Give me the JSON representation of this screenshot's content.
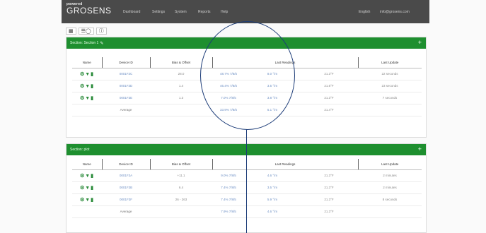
{
  "brand": {
    "tagline": "powered",
    "name": "GROSENS"
  },
  "nav": {
    "left": [
      "Dashboard",
      "Settings",
      "System",
      "Reports",
      "Help"
    ],
    "language": "English",
    "user": "info@grosens.com"
  },
  "toolbar": {
    "grid_view": "▦",
    "list_view": "☰◯",
    "info": "ⓘ"
  },
  "panels": [
    {
      "title": "Section: Section 1",
      "columns": {
        "name": "Name",
        "device": "Device ID",
        "bias": "Bias & Offset",
        "readings": "Last Readings",
        "update": "Last Update"
      },
      "rows": [
        {
          "icons": "⚙▼▮",
          "device": "0001F3C",
          "bias": "28.0",
          "time": "48.7% 7/8/5",
          "value": "8.0 °/m",
          "extra": "21.3°F",
          "update": "22 seconds"
        },
        {
          "icons": "⚙▼▮",
          "device": "0001F3D",
          "bias": "1.4",
          "time": "46.4% 7/8/5",
          "value": "3.5 °/m",
          "extra": "21.6°F",
          "update": "23 seconds"
        },
        {
          "icons": "⚙▼▮",
          "device": "0001F3E",
          "bias": "1.3",
          "time": "7.0% 7/8/5",
          "value": "3.8 °/m",
          "extra": "21.3°F",
          "update": "7 seconds"
        }
      ],
      "average": {
        "label": "Average",
        "time": "33.9% 7/8/5",
        "value": "5.1 °/m",
        "extra": "21.4°F"
      }
    },
    {
      "title": "Section: plot",
      "columns": {
        "name": "Name",
        "device": "Device ID",
        "bias": "Bias & Offset",
        "readings": "Last Readings",
        "update": "Last Update"
      },
      "rows": [
        {
          "icons": "⚙▼▮",
          "device": "0001F3A",
          "bias": "+11.1",
          "time": "9.0% 7/8/5",
          "value": "4.6 °/m",
          "extra": "21.3°F",
          "update": "2 minutes"
        },
        {
          "icons": "⚙▼▮",
          "device": "0001F3B",
          "bias": "6.4",
          "time": "7.4% 7/8/5",
          "value": "3.5 °/m",
          "extra": "21.3°F",
          "update": "2 minutes"
        },
        {
          "icons": "⚙▼▮",
          "device": "0001F3F",
          "bias": "26 - 263",
          "time": "7.4% 7/8/5",
          "value": "5.9 °/m",
          "extra": "21.3°F",
          "update": "8 seconds"
        }
      ],
      "average": {
        "label": "Average",
        "time": "7.9% 7/8/5",
        "value": "4.6 °/m",
        "extra": "21.3°F"
      }
    }
  ]
}
